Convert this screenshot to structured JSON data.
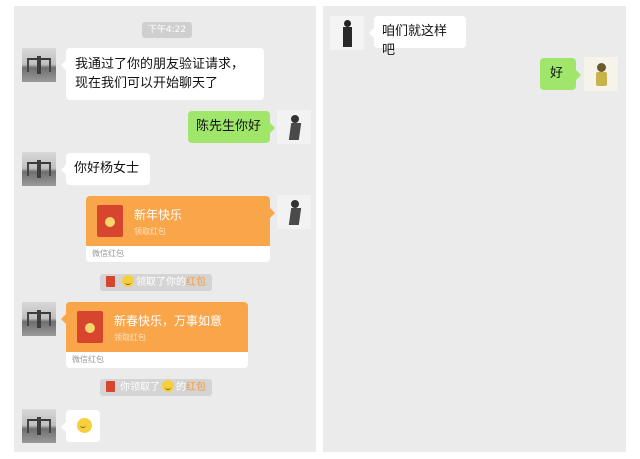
{
  "left_panel": {
    "timestamp": "下午4:22",
    "messages": [
      {
        "text": "我通过了你的朋友验证请求，现在我们可以开始聊天了"
      },
      {
        "text": "陈先生你好"
      },
      {
        "text": "你好杨女士"
      }
    ],
    "red_packet_1": {
      "greeting": "新年快乐",
      "action": "领取红包",
      "footer": "微信红包"
    },
    "notice_1": {
      "prefix": "领取了你的",
      "link": "红包"
    },
    "red_packet_2": {
      "greeting": "新春快乐，万事如意",
      "action": "领取红包",
      "footer": "微信红包"
    },
    "notice_2": {
      "prefix": "你领取了",
      "middle": "的",
      "link": "红包"
    }
  },
  "right_panel": {
    "messages": [
      {
        "text": "咱们就这样吧"
      },
      {
        "text": "好"
      }
    ]
  },
  "colors": {
    "panel_bg": "#ebebeb",
    "outgoing_bubble": "#9fe66a",
    "incoming_bubble": "#ffffff",
    "red_packet": "#f9a54a",
    "packet_highlight": "#f59a3a"
  },
  "icons": [
    "bridge-avatar",
    "sketch-avatar",
    "figure-avatar",
    "girl-avatar",
    "red-envelope-icon",
    "smile-emoji-icon"
  ]
}
